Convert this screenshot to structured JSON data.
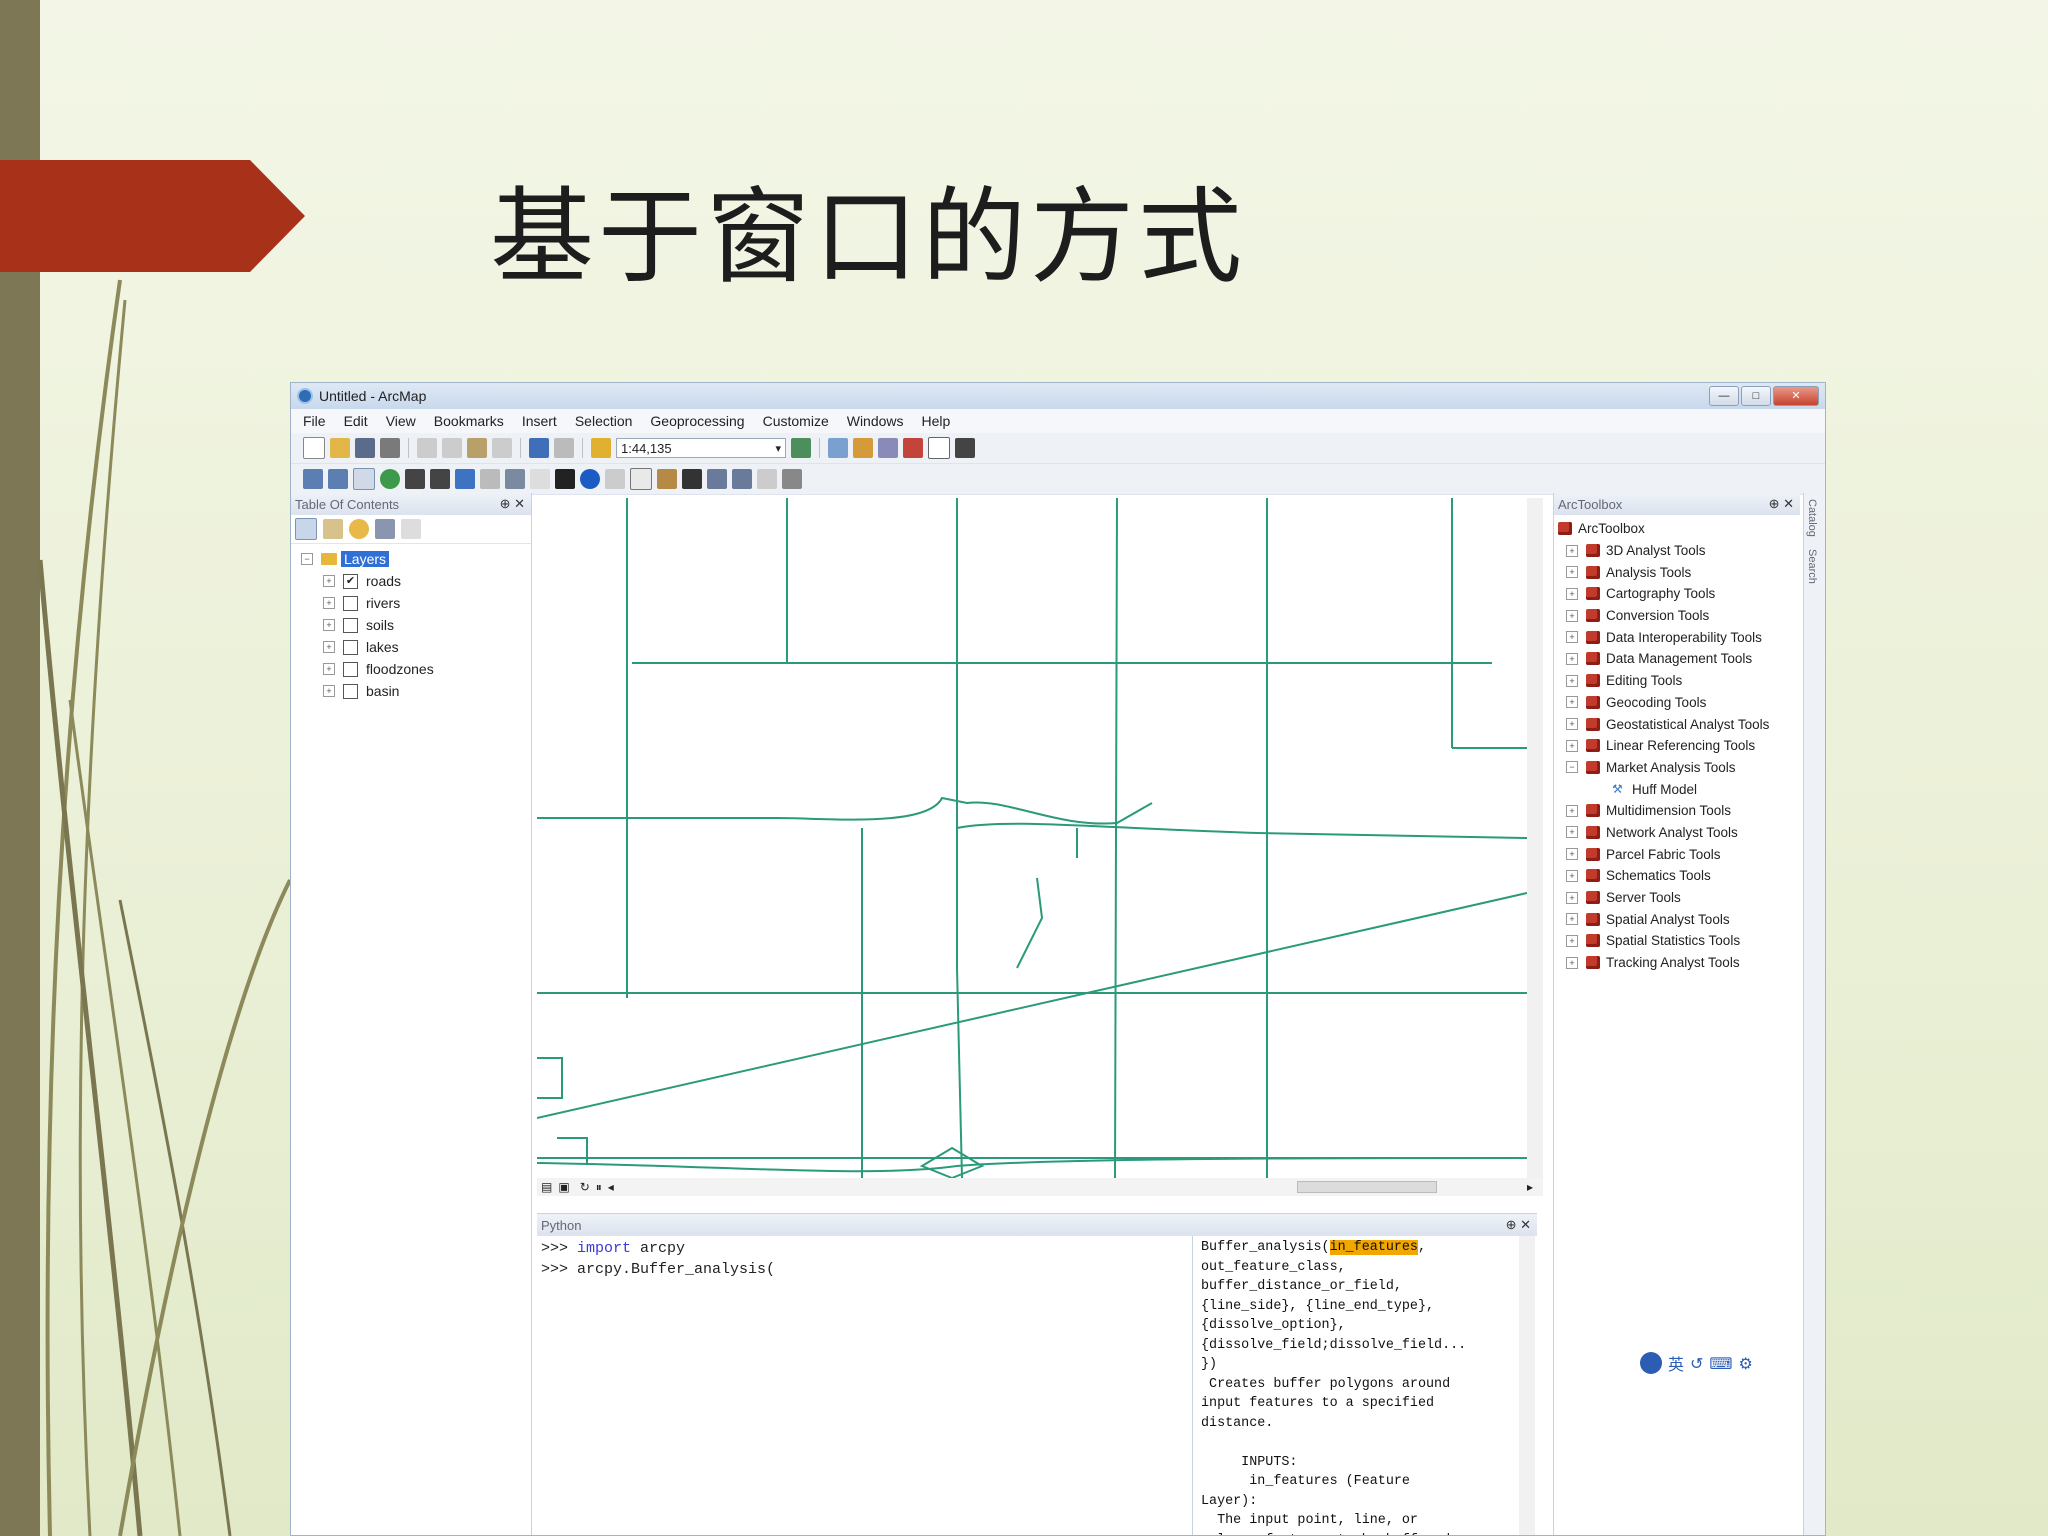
{
  "slide": {
    "title": "基于窗口的方式"
  },
  "arcmap": {
    "window_title": "Untitled - ArcMap",
    "window_controls": {
      "minimize": "—",
      "maximize": "□",
      "close": "✕"
    },
    "menu": [
      "File",
      "Edit",
      "View",
      "Bookmarks",
      "Insert",
      "Selection",
      "Geoprocessing",
      "Customize",
      "Windows",
      "Help"
    ],
    "scale_value": "1:44,135",
    "toc": {
      "title": "Table Of Contents",
      "pin": "⊕ ✕",
      "root": "Layers",
      "layers": [
        {
          "name": "roads",
          "checked": true
        },
        {
          "name": "rivers",
          "checked": false
        },
        {
          "name": "soils",
          "checked": false
        },
        {
          "name": "lakes",
          "checked": false
        },
        {
          "name": "floodzones",
          "checked": false
        },
        {
          "name": "basin",
          "checked": false
        }
      ]
    },
    "toolbox": {
      "title": "ArcToolbox",
      "pin": "⊕ ✕",
      "root": "ArcToolbox",
      "items": [
        "3D Analyst Tools",
        "Analysis Tools",
        "Cartography Tools",
        "Conversion Tools",
        "Data Interoperability Tools",
        "Data Management Tools",
        "Editing Tools",
        "Geocoding Tools",
        "Geostatistical Analyst Tools",
        "Linear Referencing Tools",
        "Market Analysis Tools"
      ],
      "child": "Huff Model",
      "items_after": [
        "Multidimension Tools",
        "Network Analyst Tools",
        "Parcel Fabric Tools",
        "Schematics Tools",
        "Server Tools",
        "Spatial Analyst Tools",
        "Spatial Statistics Tools",
        "Tracking Analyst Tools"
      ]
    },
    "side_tabs": [
      "Catalog",
      "Search"
    ],
    "python": {
      "title": "Python",
      "pin": "⊕ ✕",
      "prompt": ">>>",
      "line1_kw": "import",
      "line1_rest": " arcpy",
      "line2": "arcpy.Buffer_analysis(",
      "help_first": "Buffer_analysis(",
      "help_highlight": "in_features",
      "help_first_after": ",",
      "help_rest": "out_feature_class,\nbuffer_distance_or_field,\n{line_side}, {line_end_type},\n{dissolve_option},\n{dissolve_field;dissolve_field...\n})\n Creates buffer polygons around\ninput features to a specified\ndistance.\n\n     INPUTS:\n      in_features (Feature\nLayer):\n  The input point, line, or\npolygon features to be buffered."
    },
    "map_line_color": "#2a9a7a",
    "ime_label": "英"
  }
}
